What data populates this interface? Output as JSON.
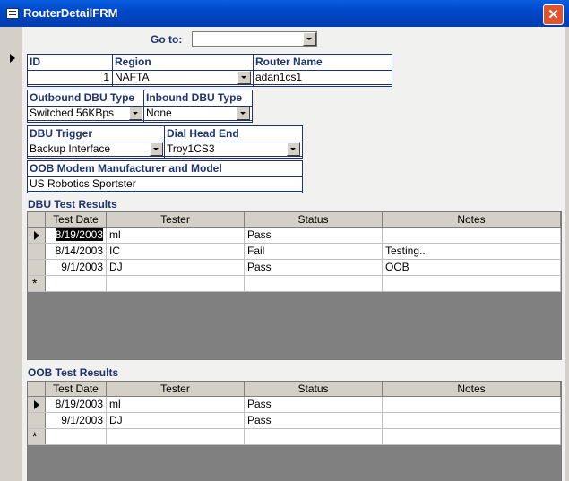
{
  "window": {
    "title": "RouterDetailFRM",
    "close_glyph": "✕"
  },
  "goto": {
    "label": "Go to:",
    "value": ""
  },
  "fields": {
    "id": {
      "label": "ID",
      "value": "1"
    },
    "region": {
      "label": "Region",
      "value": "NAFTA"
    },
    "router_name": {
      "label": "Router Name",
      "value": "adan1cs1"
    },
    "outbound_dbu_type": {
      "label": "Outbound DBU Type",
      "value": "Switched 56KBps"
    },
    "inbound_dbu_type": {
      "label": "Inbound DBU Type",
      "value": "None"
    },
    "dbu_trigger": {
      "label": "DBU Trigger",
      "value": "Backup Interface"
    },
    "dial_head_end": {
      "label": "Dial Head End",
      "value": "Troy1CS3"
    },
    "oob_modem": {
      "label": "OOB Modem Manufacturer and Model",
      "value": "US Robotics Sportster"
    }
  },
  "dbu_results": {
    "title": "DBU Test Results",
    "columns": [
      "Test Date",
      "Tester",
      "Status",
      "Notes"
    ],
    "rows": [
      {
        "test_date": "8/19/2003",
        "tester": "ml",
        "status": "Pass",
        "notes": ""
      },
      {
        "test_date": "8/14/2003",
        "tester": "IC",
        "status": "Fail",
        "notes": "Testing..."
      },
      {
        "test_date": "9/1/2003",
        "tester": "DJ",
        "status": "Pass",
        "notes": "OOB"
      }
    ],
    "new_row_glyph": "*"
  },
  "oob_results": {
    "title": "OOB Test Results",
    "columns": [
      "Test Date",
      "Tester",
      "Status",
      "Notes"
    ],
    "rows": [
      {
        "test_date": "8/19/2003",
        "tester": "ml",
        "status": "Pass",
        "notes": ""
      },
      {
        "test_date": "9/1/2003",
        "tester": "DJ",
        "status": "Pass",
        "notes": ""
      }
    ],
    "new_row_glyph": "*"
  },
  "colors": {
    "title_bar": "#0048c8",
    "label": "#1f3370",
    "close_button": "#e0542c"
  }
}
